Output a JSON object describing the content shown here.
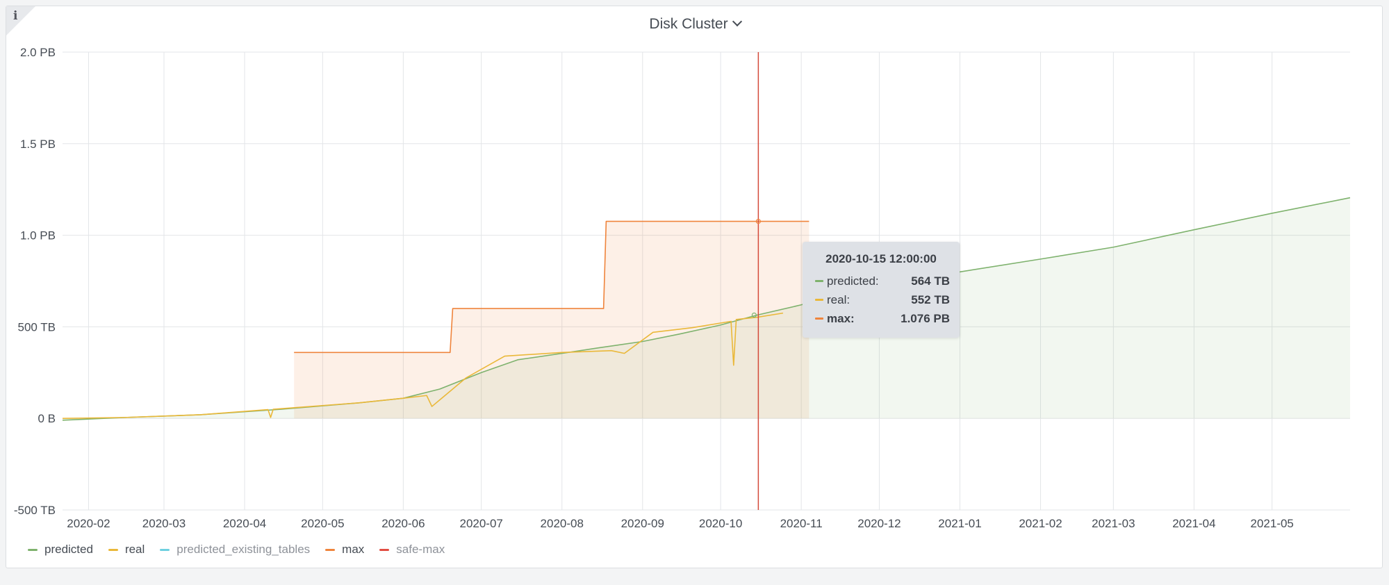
{
  "panel": {
    "title": "Disk Cluster",
    "info_glyph": "i"
  },
  "chart_data": {
    "type": "area",
    "title": "Disk Cluster",
    "x_axis": {
      "type": "time",
      "ticks": [
        "2020-02",
        "2020-03",
        "2020-04",
        "2020-05",
        "2020-06",
        "2020-07",
        "2020-08",
        "2020-09",
        "2020-10",
        "2020-11",
        "2020-12",
        "2021-01",
        "2021-02",
        "2021-03",
        "2021-04",
        "2021-05"
      ],
      "range": [
        "2020-01-22",
        "2021-05-31"
      ]
    },
    "y_axis": {
      "unit": "TB",
      "range": [
        -500,
        2000
      ],
      "ticks": [
        {
          "value": -500,
          "label": "-500 TB"
        },
        {
          "value": 0,
          "label": "0 B"
        },
        {
          "value": 500,
          "label": "500 TB"
        },
        {
          "value": 1000,
          "label": "1.0 PB"
        },
        {
          "value": 1500,
          "label": "1.5 PB"
        },
        {
          "value": 2000,
          "label": "2.0 PB"
        }
      ]
    },
    "grid": true,
    "legend_placement": "bottom-left",
    "series": [
      {
        "name": "predicted",
        "color": "#7eb26d",
        "fill": true,
        "points": [
          [
            "2020-01-22",
            -10
          ],
          [
            "2020-02-15",
            5
          ],
          [
            "2020-03-15",
            20
          ],
          [
            "2020-04-15",
            50
          ],
          [
            "2020-05-15",
            85
          ],
          [
            "2020-06-01",
            110
          ],
          [
            "2020-06-15",
            160
          ],
          [
            "2020-07-01",
            250
          ],
          [
            "2020-07-15",
            320
          ],
          [
            "2020-08-01",
            355
          ],
          [
            "2020-08-15",
            385
          ],
          [
            "2020-09-01",
            420
          ],
          [
            "2020-09-15",
            460
          ],
          [
            "2020-10-01",
            510
          ],
          [
            "2020-10-15",
            564
          ],
          [
            "2020-11-01",
            620
          ],
          [
            "2020-11-15",
            680
          ],
          [
            "2020-12-01",
            730
          ],
          [
            "2021-01-01",
            800
          ],
          [
            "2021-02-01",
            870
          ],
          [
            "2021-03-01",
            935
          ],
          [
            "2021-04-01",
            1030
          ],
          [
            "2021-05-01",
            1120
          ],
          [
            "2021-05-31",
            1205
          ]
        ]
      },
      {
        "name": "real",
        "color": "#eab839",
        "fill": false,
        "points": [
          [
            "2020-01-22",
            0
          ],
          [
            "2020-02-15",
            5
          ],
          [
            "2020-03-15",
            20
          ],
          [
            "2020-04-10",
            48
          ],
          [
            "2020-04-11",
            5
          ],
          [
            "2020-04-12",
            50
          ],
          [
            "2020-05-15",
            85
          ],
          [
            "2020-06-01",
            110
          ],
          [
            "2020-06-10",
            125
          ],
          [
            "2020-06-12",
            65
          ],
          [
            "2020-06-25",
            220
          ],
          [
            "2020-07-10",
            340
          ],
          [
            "2020-08-01",
            360
          ],
          [
            "2020-08-20",
            370
          ],
          [
            "2020-08-25",
            355
          ],
          [
            "2020-09-05",
            470
          ],
          [
            "2020-09-20",
            495
          ],
          [
            "2020-10-05",
            530
          ],
          [
            "2020-10-06",
            290
          ],
          [
            "2020-10-07",
            540
          ],
          [
            "2020-10-15",
            552
          ],
          [
            "2020-10-25",
            575
          ]
        ]
      },
      {
        "name": "predicted_existing_tables",
        "color": "#6ed0e0",
        "fill": false,
        "points": []
      },
      {
        "name": "max",
        "color": "#ef843c",
        "fill": true,
        "points": [
          [
            "2020-04-20",
            360
          ],
          [
            "2020-06-19",
            360
          ],
          [
            "2020-06-20",
            600
          ],
          [
            "2020-08-17",
            600
          ],
          [
            "2020-08-18",
            1076
          ],
          [
            "2020-11-04",
            1076
          ]
        ]
      },
      {
        "name": "safe-max",
        "color": "#e24d42",
        "fill": false,
        "points": []
      }
    ],
    "cursor": {
      "time": "2020-10-15 12:00:00"
    },
    "tooltip": {
      "time": "2020-10-15 12:00:00",
      "rows": [
        {
          "name": "predicted:",
          "value": "564 TB",
          "color": "#7eb26d",
          "bold": false
        },
        {
          "name": "real:",
          "value": "552 TB",
          "color": "#eab839",
          "bold": false
        },
        {
          "name": "max:",
          "value": "1.076 PB",
          "color": "#ef843c",
          "bold": true
        }
      ]
    }
  },
  "legend": {
    "items": [
      {
        "label": "predicted",
        "color": "#7eb26d",
        "dim": false
      },
      {
        "label": "real",
        "color": "#eab839",
        "dim": false
      },
      {
        "label": "predicted_existing_tables",
        "color": "#6ed0e0",
        "dim": true
      },
      {
        "label": "max",
        "color": "#ef843c",
        "dim": false
      },
      {
        "label": "safe-max",
        "color": "#e24d42",
        "dim": true
      }
    ]
  }
}
